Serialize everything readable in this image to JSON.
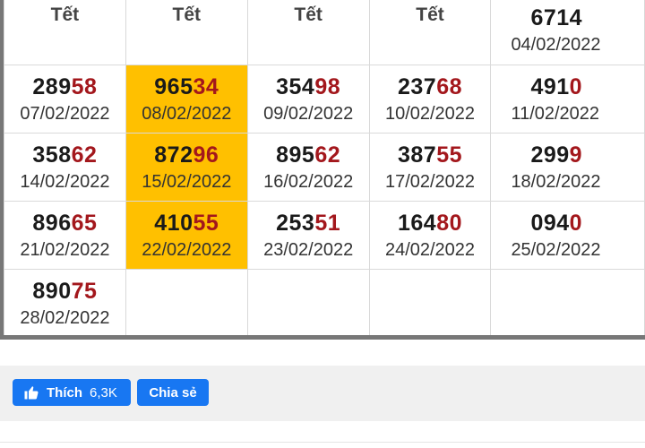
{
  "header": {
    "cells": [
      "Tết",
      "Tết",
      "Tết",
      "Tết"
    ],
    "last_num": "6714",
    "last_date": "04/02/2022"
  },
  "rows": [
    [
      {
        "lead": "289",
        "tail": "58",
        "date": "07/02/2022"
      },
      {
        "lead": "965",
        "tail": "34",
        "date": "08/02/2022",
        "hl": true
      },
      {
        "lead": "354",
        "tail": "98",
        "date": "09/02/2022"
      },
      {
        "lead": "237",
        "tail": "68",
        "date": "10/02/2022"
      },
      {
        "lead": "491",
        "tail": "0",
        "date": "11/02/2022"
      }
    ],
    [
      {
        "lead": "358",
        "tail": "62",
        "date": "14/02/2022"
      },
      {
        "lead": "872",
        "tail": "96",
        "date": "15/02/2022",
        "hl": true
      },
      {
        "lead": "895",
        "tail": "62",
        "date": "16/02/2022"
      },
      {
        "lead": "387",
        "tail": "55",
        "date": "17/02/2022"
      },
      {
        "lead": "299",
        "tail": "9",
        "date": "18/02/2022"
      }
    ],
    [
      {
        "lead": "896",
        "tail": "65",
        "date": "21/02/2022"
      },
      {
        "lead": "410",
        "tail": "55",
        "date": "22/02/2022",
        "hl": true
      },
      {
        "lead": "253",
        "tail": "51",
        "date": "23/02/2022"
      },
      {
        "lead": "164",
        "tail": "80",
        "date": "24/02/2022"
      },
      {
        "lead": "094",
        "tail": "0",
        "date": "25/02/2022"
      }
    ],
    [
      {
        "lead": "890",
        "tail": "75",
        "date": "28/02/2022"
      }
    ]
  ],
  "colors": {
    "highlight": "#ffc000",
    "tail_digits": "#a3171c",
    "facebook_blue": "#1877f2"
  },
  "social": {
    "like_label": "Thích",
    "like_count": "6,3K",
    "share_label": "Chia sẻ",
    "like_icon": "thumbs-up-icon"
  }
}
